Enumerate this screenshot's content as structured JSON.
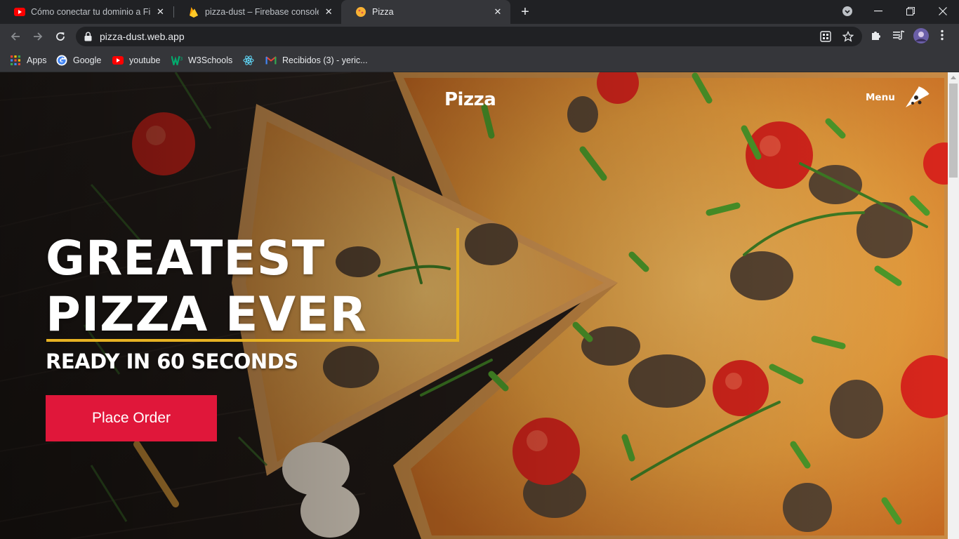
{
  "browser": {
    "tabs": [
      {
        "title": "Cómo conectar tu dominio a Fire",
        "favicon": "youtube-icon",
        "active": false
      },
      {
        "title": "pizza-dust – Firebase console",
        "favicon": "firebase-icon",
        "active": false
      },
      {
        "title": "Pizza",
        "favicon": "pizza-favicon-icon",
        "active": true
      }
    ],
    "url": "pizza-dust.web.app",
    "bookmarks": [
      {
        "label": "Apps",
        "icon": "apps-grid-icon"
      },
      {
        "label": "Google",
        "icon": "google-icon"
      },
      {
        "label": "youtube",
        "icon": "youtube-icon"
      },
      {
        "label": "W3Schools",
        "icon": "w3schools-icon"
      },
      {
        "label": "",
        "icon": "react-icon"
      },
      {
        "label": "Recibidos (3) - yeric...",
        "icon": "gmail-icon"
      }
    ]
  },
  "page": {
    "brand": "Pizza",
    "menu_label": "Menu",
    "headline_line1": "GREATEST",
    "headline_line2": "PIZZA EVER",
    "subheadline": "READY IN 60 SECONDS",
    "cta_label": "Place Order"
  },
  "colors": {
    "accent_gold": "#e7b223",
    "cta_red": "#e0173a",
    "chrome_dark": "#202124",
    "chrome_toolbar": "#35363a"
  }
}
